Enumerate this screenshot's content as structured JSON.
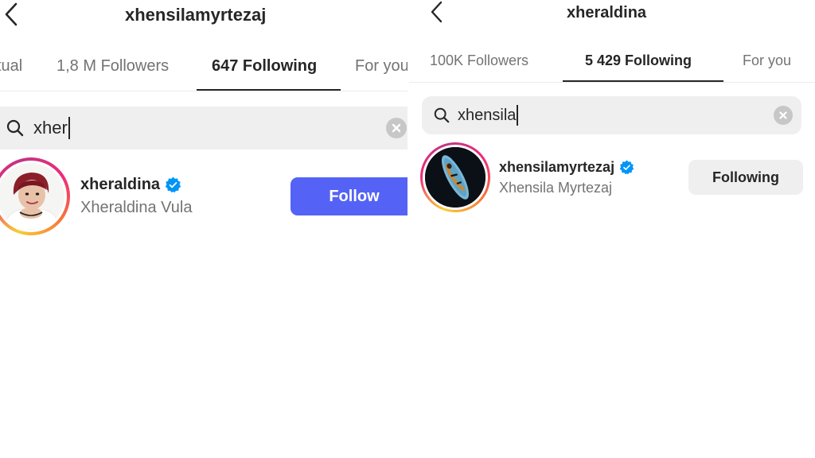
{
  "left": {
    "title": "xhensilamyrtezaj",
    "tabs": [
      {
        "label": "tual"
      },
      {
        "label": "1,8 M Followers"
      },
      {
        "label": "647 Following",
        "active": true
      },
      {
        "label": "For you"
      }
    ],
    "search": {
      "value": "xher"
    },
    "result": {
      "username": "xheraldina",
      "full_name": "Xheraldina Vula",
      "button_label": "Follow",
      "verified": true
    }
  },
  "right": {
    "title": "xheraldina",
    "tabs": [
      {
        "label": "100K Followers"
      },
      {
        "label": "5 429 Following",
        "active": true
      },
      {
        "label": "For you"
      }
    ],
    "search": {
      "value": "xhensila"
    },
    "result": {
      "username": "xhensilamyrtezaj",
      "full_name": "Xhensila Myrtezaj",
      "button_label": "Following",
      "verified": true
    }
  },
  "colors": {
    "follow_button": "#5463f5",
    "following_button": "#efefef",
    "verified_badge": "#0095f6",
    "active_tab_underline": "#262626",
    "search_bg": "#efefef"
  },
  "icons": {
    "back": "chevron-left-icon",
    "search": "search-icon",
    "clear": "clear-icon",
    "verified": "verified-badge-icon"
  }
}
